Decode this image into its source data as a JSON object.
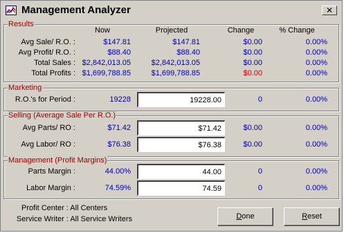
{
  "window": {
    "title": "Management Analyzer",
    "close_glyph": "✕",
    "app_icon": "chart-icon"
  },
  "results": {
    "legend": "Results",
    "headers": {
      "now": "Now",
      "projected": "Projected",
      "change": "Change",
      "pct_change": "% Change"
    },
    "rows": [
      {
        "label": "Avg Sale/ R.O. :",
        "now": "$147.81",
        "projected": "$147.81",
        "change": "$0.00",
        "pct": "0.00%"
      },
      {
        "label": "Avg Profit/ R.O. :",
        "now": "$88.40",
        "projected": "$88.40",
        "change": "$0.00",
        "pct": "0.00%"
      },
      {
        "label": "Total Sales :",
        "now": "$2,842,013.05",
        "projected": "$2,842,013.05",
        "change": "$0.00",
        "pct": "0.00%"
      },
      {
        "label": "Total Profits :",
        "now": "$1,699,788.85",
        "projected": "$1,699,788.85",
        "change": "$0.00",
        "pct": "0.00%"
      }
    ]
  },
  "marketing": {
    "legend": "Marketing",
    "rows": [
      {
        "label": "R.O.'s for Period :",
        "now": "19228",
        "input": "19228.00",
        "change": "0",
        "pct": "0.00%"
      }
    ]
  },
  "selling": {
    "legend": "Selling (Average Sale Per R.O.)",
    "rows": [
      {
        "label": "Avg Parts/ RO :",
        "now": "$71.42",
        "input": "$71.42",
        "change": "$0.00",
        "pct": "0.00%"
      },
      {
        "label": "Avg Labor/ RO :",
        "now": "$76.38",
        "input": "$76.38",
        "change": "$0.00",
        "pct": "0.00%"
      }
    ]
  },
  "management": {
    "legend": "Management (Profit Margins)",
    "rows": [
      {
        "label": "Parts Margin :",
        "now": "44.00%",
        "input": "44.00",
        "change": "0",
        "pct": "0.00%"
      },
      {
        "label": "Labor Margin :",
        "now": "74.59%",
        "input": "74.59",
        "change": "0",
        "pct": "0.00%"
      }
    ]
  },
  "footer": {
    "profit_center": "Profit Center : All Centers",
    "service_writer": "Service Writer : All Service Writers",
    "done_accel": "D",
    "done_rest": "one",
    "reset_accel": "R",
    "reset_rest": "eset"
  },
  "colors": {
    "value_blue": "#0000aa",
    "negative_red": "#cc0000",
    "legend_red": "#990000",
    "face": "#d4d0c8"
  }
}
